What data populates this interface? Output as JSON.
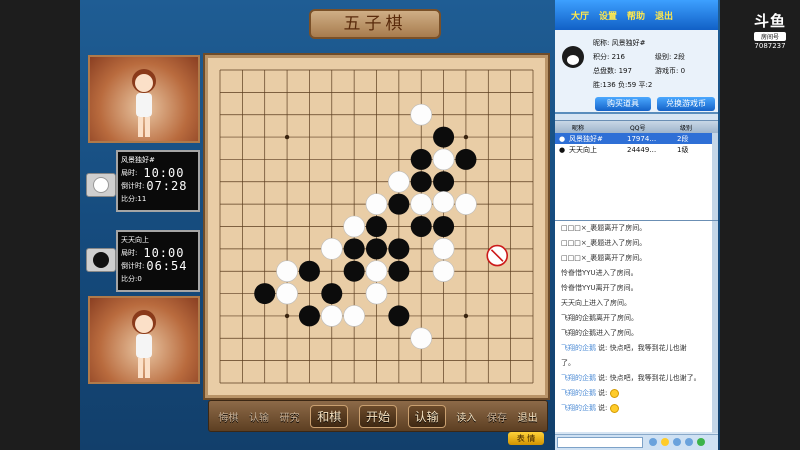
{
  "title": "五子棋",
  "players": [
    {
      "name": "风景独好#",
      "time_label": "局时:",
      "time": "10:00",
      "countdown_label": "倒计时:",
      "countdown": "07:28",
      "score_label": "比分:",
      "score": "11",
      "stone": "white"
    },
    {
      "name": "天天向上",
      "time_label": "局时:",
      "time": "10:00",
      "countdown_label": "倒计时:",
      "countdown": "06:54",
      "score_label": "比分:",
      "score": "0",
      "stone": "black"
    }
  ],
  "board": {
    "size": 15,
    "black": [
      [
        10,
        3
      ],
      [
        11,
        4
      ],
      [
        9,
        4
      ],
      [
        10,
        5
      ],
      [
        9,
        5
      ],
      [
        8,
        6
      ],
      [
        7,
        7
      ],
      [
        9,
        7
      ],
      [
        10,
        7
      ],
      [
        6,
        8
      ],
      [
        7,
        8
      ],
      [
        8,
        8
      ],
      [
        4,
        9
      ],
      [
        6,
        9
      ],
      [
        8,
        9
      ],
      [
        5,
        10
      ],
      [
        7,
        10
      ],
      [
        2,
        10
      ],
      [
        4,
        11
      ],
      [
        8,
        11
      ]
    ],
    "white": [
      [
        9,
        2
      ],
      [
        10,
        4
      ],
      [
        8,
        5
      ],
      [
        10,
        5.9
      ],
      [
        7,
        6
      ],
      [
        11,
        6
      ],
      [
        6,
        7
      ],
      [
        5,
        8
      ],
      [
        10,
        8
      ],
      [
        10,
        9
      ],
      [
        3,
        9
      ],
      [
        7,
        9
      ],
      [
        7,
        10
      ],
      [
        3,
        10
      ],
      [
        5,
        11
      ],
      [
        6,
        11
      ],
      [
        9,
        12
      ],
      [
        9,
        6
      ]
    ],
    "last_move_icon": "no-entry-icon"
  },
  "toolbar": {
    "items": [
      "悔棋",
      "认输",
      "研究",
      "和棋",
      "开始",
      "认输",
      "读入",
      "保存",
      "退出"
    ],
    "face_button": "表 情"
  },
  "menu": {
    "items": [
      "大厅",
      "设置",
      "帮助",
      "退出"
    ]
  },
  "profile": {
    "nick_label": "昵称:",
    "nick": "风景独好#",
    "points_label": "积分:",
    "points": "216",
    "level_label": "级别:",
    "level": "2段",
    "games_label": "总盘数:",
    "games": "197",
    "coins_label": "游戏币:",
    "coins": "0",
    "wins_label": "胜:",
    "wins": "136",
    "losses_label": "负:",
    "losses": "59",
    "draws_label": "平:",
    "draws": "2",
    "buy_button": "购买道具",
    "exchange_button": "兑换游戏币"
  },
  "user_list": {
    "headers": [
      "",
      "昵称",
      "QQ号",
      "级别"
    ],
    "rows": [
      {
        "name": "风景独好#",
        "qq": "17974…",
        "level": "2段",
        "selected": true
      },
      {
        "name": "天天向上",
        "qq": "24449…",
        "level": "1级",
        "selected": false
      }
    ]
  },
  "chat": {
    "messages": [
      {
        "nick": "",
        "text": "□□□×_裹题离开了房间。"
      },
      {
        "nick": "",
        "text": "□□□×_裹题进入了房间。"
      },
      {
        "nick": "",
        "text": "□□□×_裹题离开了房间。"
      },
      {
        "nick": "",
        "text": "怜眷惜YYU进入了房间。"
      },
      {
        "nick": "",
        "text": "怜眷惜YYU离开了房间。"
      },
      {
        "nick": "",
        "text": "天天向上进入了房间。"
      },
      {
        "nick": "",
        "text": "飞翔的企鹅离开了房间。"
      },
      {
        "nick": "",
        "text": "飞翔的企鹅进入了房间。"
      },
      {
        "nick": "飞翔的企鹅",
        "text": "说: 快点吧，我等到花儿也谢"
      },
      {
        "nick": "",
        "text": "了。"
      },
      {
        "nick": "飞翔的企鹅",
        "text": "说: 快点吧，我等到花儿也谢了。"
      },
      {
        "nick": "飞翔的企鹅",
        "text": "说:",
        "emoji": true
      },
      {
        "nick": "飞翔的企鹅",
        "text": "说:",
        "emoji": true
      }
    ]
  },
  "watermark": {
    "logo": "斗鱼",
    "tag": "房间号",
    "room": "7087237"
  }
}
